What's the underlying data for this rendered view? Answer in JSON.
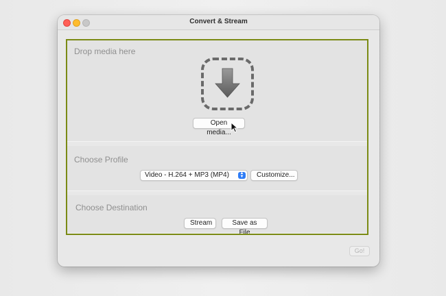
{
  "window": {
    "title": "Convert & Stream"
  },
  "drop": {
    "title": "Drop media here",
    "icon": "download-arrow-icon",
    "open_label": "Open media..."
  },
  "profile": {
    "title": "Choose Profile",
    "selected": "Video - H.264 + MP3 (MP4)",
    "customize_label": "Customize..."
  },
  "destination": {
    "title": "Choose Destination",
    "stream_label": "Stream",
    "save_label": "Save as File"
  },
  "footer": {
    "go_label": "Go!"
  },
  "colors": {
    "highlight_border": "#7a8a14",
    "select_accent": "#2e7cf6"
  }
}
